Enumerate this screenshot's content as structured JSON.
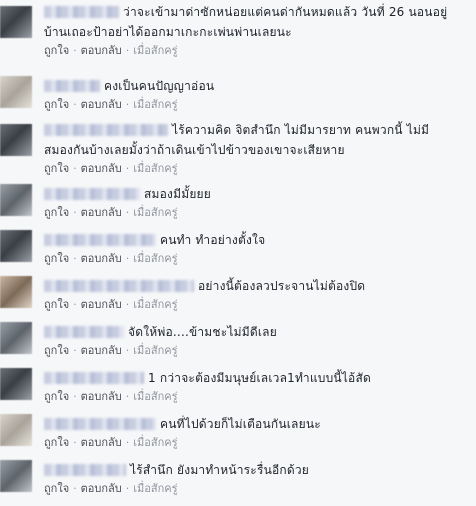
{
  "actions": {
    "like": "ถูกใจ",
    "reply": "ตอบกลับ",
    "separator": "·",
    "time": "เมื่อสักครู่"
  },
  "comments": [
    {
      "line1": "ว่าจะเข้ามาด่าซักหน่อยแต่คนด่ากันหมดแล้ว วันที่ 26 นอนอยู่",
      "line2": "บ้านเถอะป้าอย่าได้ออกมาเกะกะเพ่นพ่านเลยนะ"
    },
    {
      "line1": "คงเป็นคนปัญญาอ่อน"
    },
    {
      "line1": "ไร้ความคิด จิตสำนึก ไม่มีมารยาท คนพวกนี้ ไม่มี",
      "line2": "สมองกันบ้างเลยมั้งว่าถ้าเดินเข้าไปข้าวของเขาจะเสียหาย"
    },
    {
      "line1": "สมองมีมั้ยยย"
    },
    {
      "line1": "คนทำ ทำอย่างตั้งใจ"
    },
    {
      "line1": "อย่างนี้ต้องลวประจานไม่ต้องปิด"
    },
    {
      "line1": "จัดให้พ่อ....ข้ามชะไม่มีดีเลย"
    },
    {
      "line1": "1 กว่าจะต้องมีมนุษย์เลเวล1ทำแบบนี้ไอ้สัด"
    },
    {
      "line1": "คนที่ไปด้วยก็ไม่เตือนกันเลยนะ"
    },
    {
      "line1": "ไร้สำนึก ยังมาทำหน้าระรื่นอีกด้วย"
    }
  ]
}
